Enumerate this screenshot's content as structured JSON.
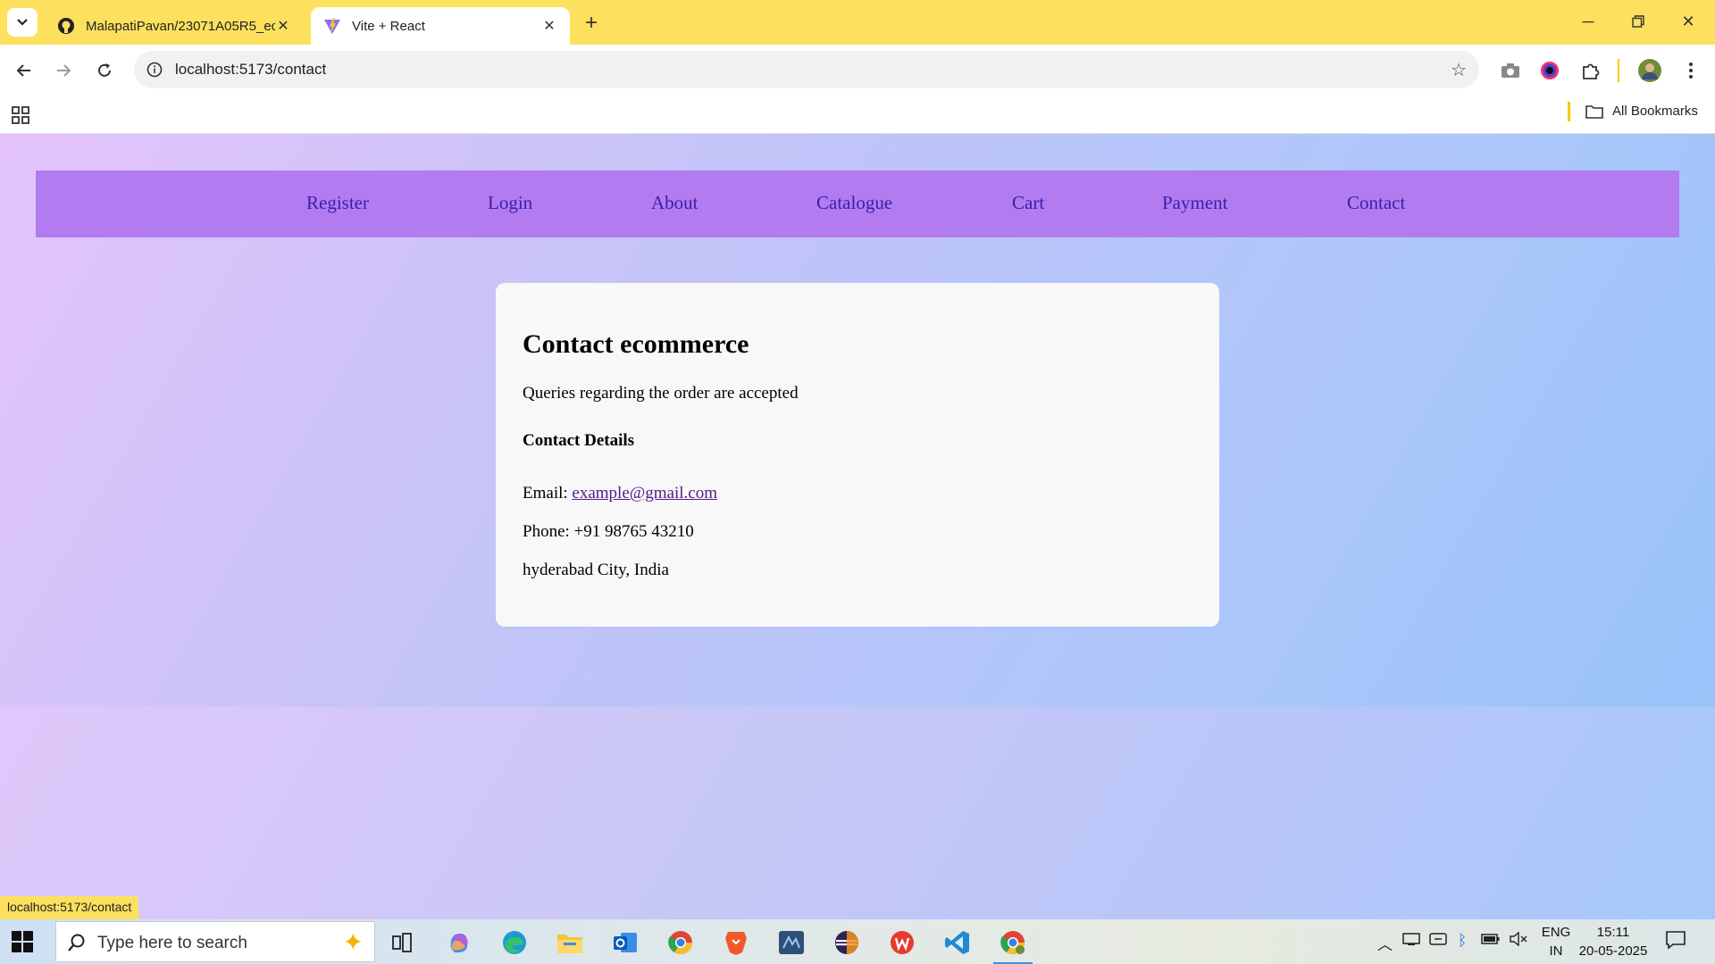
{
  "browser": {
    "tabs": [
      {
        "title": "MalapatiPavan/23071A05R5_ec",
        "favicon": "github-icon",
        "active": false
      },
      {
        "title": "Vite + React",
        "favicon": "vite-icon",
        "active": true
      }
    ],
    "url": "localhost:5173/contact",
    "bookmarks_label": "All Bookmarks",
    "status_url": "localhost:5173/contact"
  },
  "site_nav": {
    "items": [
      "Register",
      "Login",
      "About",
      "Catalogue",
      "Cart",
      "Payment",
      "Contact"
    ]
  },
  "contact": {
    "heading": "Contact ecommerce",
    "intro": "Queries regarding the order are accepted",
    "details_heading": "Contact Details",
    "email_label": "Email: ",
    "email": "example@gmail.com",
    "phone": "Phone: +91 98765 43210",
    "address": "hyderabad City, India"
  },
  "taskbar": {
    "search_placeholder": "Type here to search",
    "lang_line1": "ENG",
    "lang_line2": "IN",
    "time": "15:11",
    "date": "20-05-2025"
  },
  "colors": {
    "tab_bar": "#fde05e",
    "site_nav_bg": "#b27bf0",
    "site_nav_link": "#3a1fa8",
    "card_bg": "#f8f8f8",
    "link_visited": "#551a8b"
  }
}
